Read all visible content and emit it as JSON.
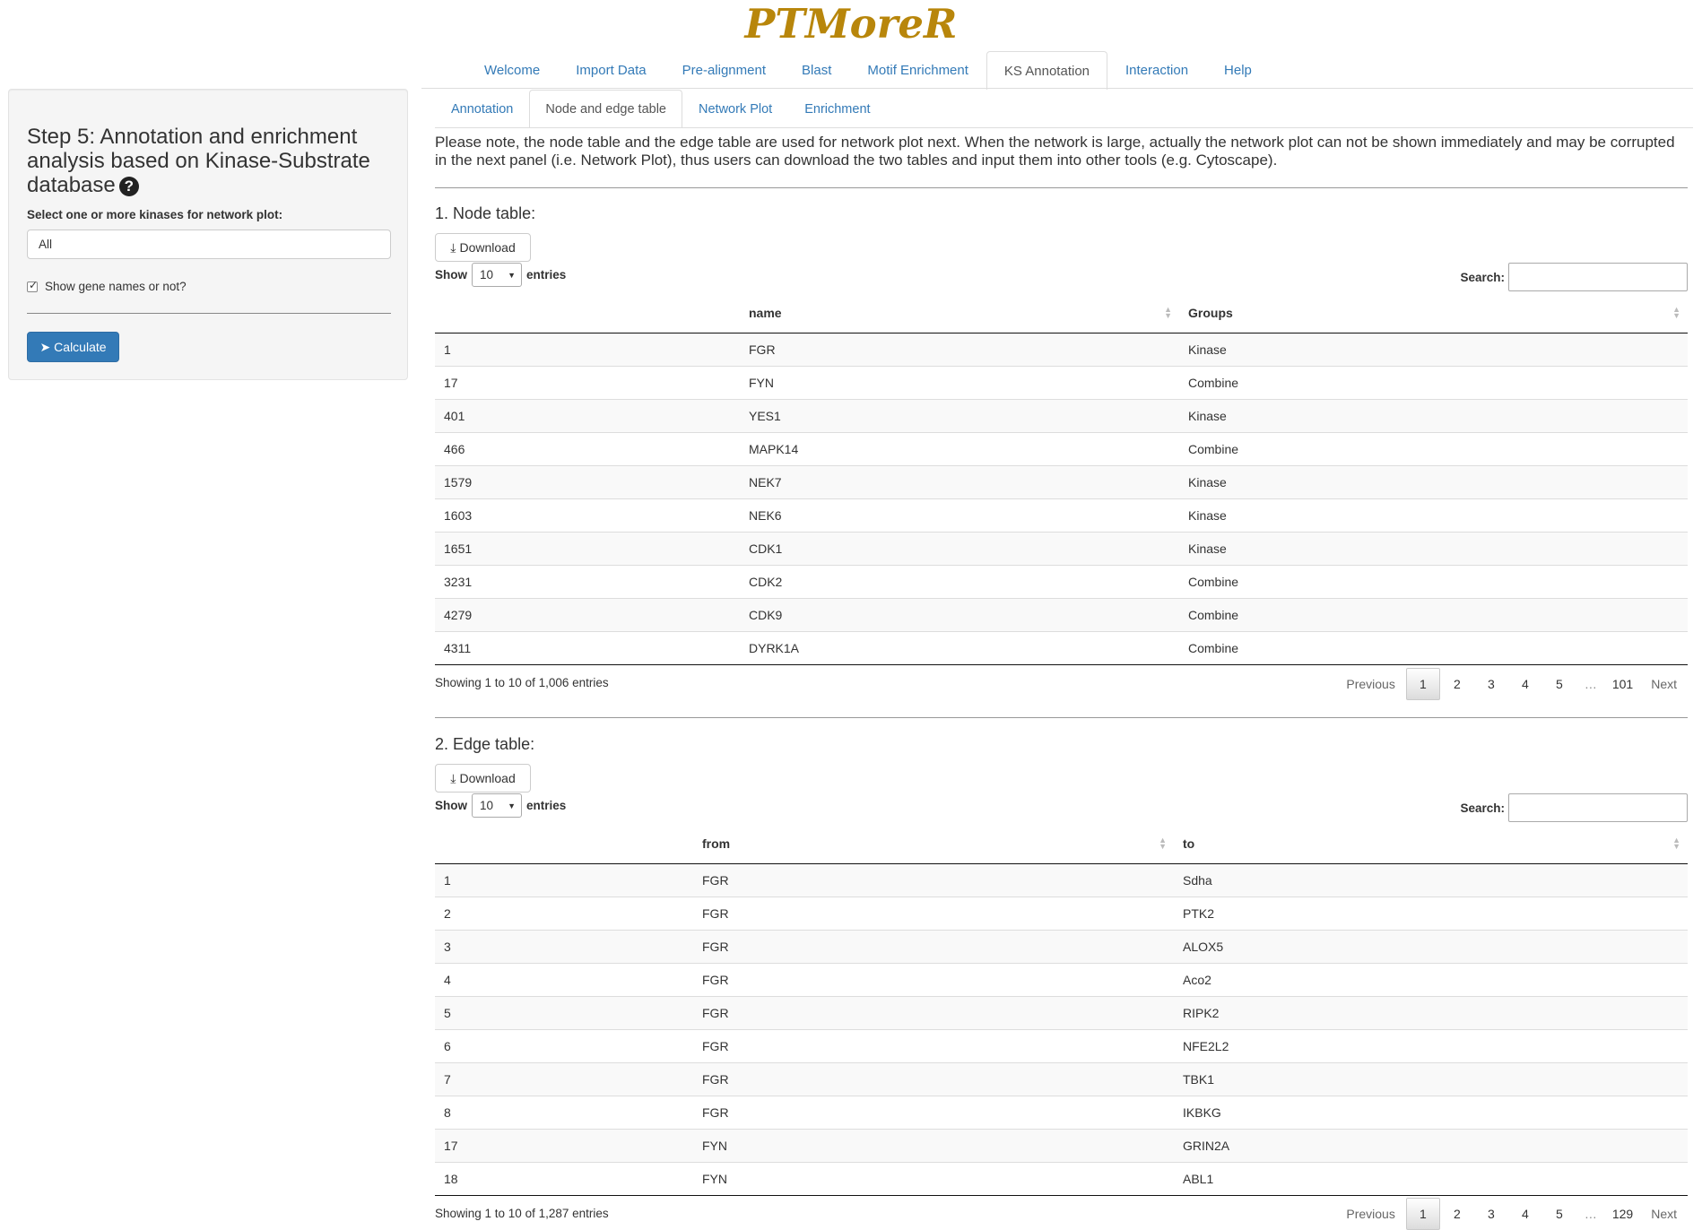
{
  "app": {
    "title": "PTMoreR"
  },
  "main_nav": {
    "tabs": [
      {
        "label": "Welcome"
      },
      {
        "label": "Import Data"
      },
      {
        "label": "Pre-alignment"
      },
      {
        "label": "Blast"
      },
      {
        "label": "Motif Enrichment"
      },
      {
        "label": "KS Annotation",
        "active": true
      },
      {
        "label": "Interaction"
      },
      {
        "label": "Help"
      }
    ]
  },
  "sidebar": {
    "title": "Step 5: Annotation and enrichment analysis based on Kinase-Substrate database",
    "help_icon": "question-circle-icon",
    "kinase_label": "Select one or more kinases for network plot:",
    "kinase_value": "All",
    "show_gene_names_label": "Show gene names or not?",
    "show_gene_names_checked": true,
    "calculate_label": "Calculate",
    "calculate_icon": "paper-plane-icon"
  },
  "sub_nav": {
    "tabs": [
      {
        "label": "Annotation"
      },
      {
        "label": "Node and edge table",
        "active": true
      },
      {
        "label": "Network Plot"
      },
      {
        "label": "Enrichment"
      }
    ]
  },
  "note": "Please note, the node table and the edge table are used for network plot next. When the network is large, actually the network plot can not be shown immediately and may be corrupted in the next panel (i.e. Network Plot), thus users can download the two tables and input them into other tools (e.g. Cytoscape).",
  "node_table": {
    "title": "1. Node table:",
    "download_label": "Download",
    "show_label": "Show",
    "entries_label": "entries",
    "length_value": "10",
    "search_label": "Search:",
    "columns": [
      "",
      "name",
      "Groups"
    ],
    "rows": [
      [
        "1",
        "FGR",
        "Kinase"
      ],
      [
        "17",
        "FYN",
        "Combine"
      ],
      [
        "401",
        "YES1",
        "Kinase"
      ],
      [
        "466",
        "MAPK14",
        "Combine"
      ],
      [
        "1579",
        "NEK7",
        "Kinase"
      ],
      [
        "1603",
        "NEK6",
        "Kinase"
      ],
      [
        "1651",
        "CDK1",
        "Kinase"
      ],
      [
        "3231",
        "CDK2",
        "Combine"
      ],
      [
        "4279",
        "CDK9",
        "Combine"
      ],
      [
        "4311",
        "DYRK1A",
        "Combine"
      ]
    ],
    "info": "Showing 1 to 10 of 1,006 entries",
    "pager": {
      "previous": "Previous",
      "pages": [
        "1",
        "2",
        "3",
        "4",
        "5"
      ],
      "ellipsis": "…",
      "last": "101",
      "next": "Next"
    }
  },
  "edge_table": {
    "title": "2. Edge table:",
    "download_label": "Download",
    "show_label": "Show",
    "entries_label": "entries",
    "length_value": "10",
    "search_label": "Search:",
    "columns": [
      "",
      "from",
      "to"
    ],
    "rows": [
      [
        "1",
        "FGR",
        "Sdha"
      ],
      [
        "2",
        "FGR",
        "PTK2"
      ],
      [
        "3",
        "FGR",
        "ALOX5"
      ],
      [
        "4",
        "FGR",
        "Aco2"
      ],
      [
        "5",
        "FGR",
        "RIPK2"
      ],
      [
        "6",
        "FGR",
        "NFE2L2"
      ],
      [
        "7",
        "FGR",
        "TBK1"
      ],
      [
        "8",
        "FGR",
        "IKBKG"
      ],
      [
        "17",
        "FYN",
        "GRIN2A"
      ],
      [
        "18",
        "FYN",
        "ABL1"
      ]
    ],
    "info": "Showing 1 to 10 of 1,287 entries",
    "pager": {
      "previous": "Previous",
      "pages": [
        "1",
        "2",
        "3",
        "4",
        "5"
      ],
      "ellipsis": "…",
      "last": "129",
      "next": "Next"
    }
  },
  "colors": {
    "brand": "#b8860b",
    "link": "#337ab7",
    "primary_button": "#337ab7"
  }
}
